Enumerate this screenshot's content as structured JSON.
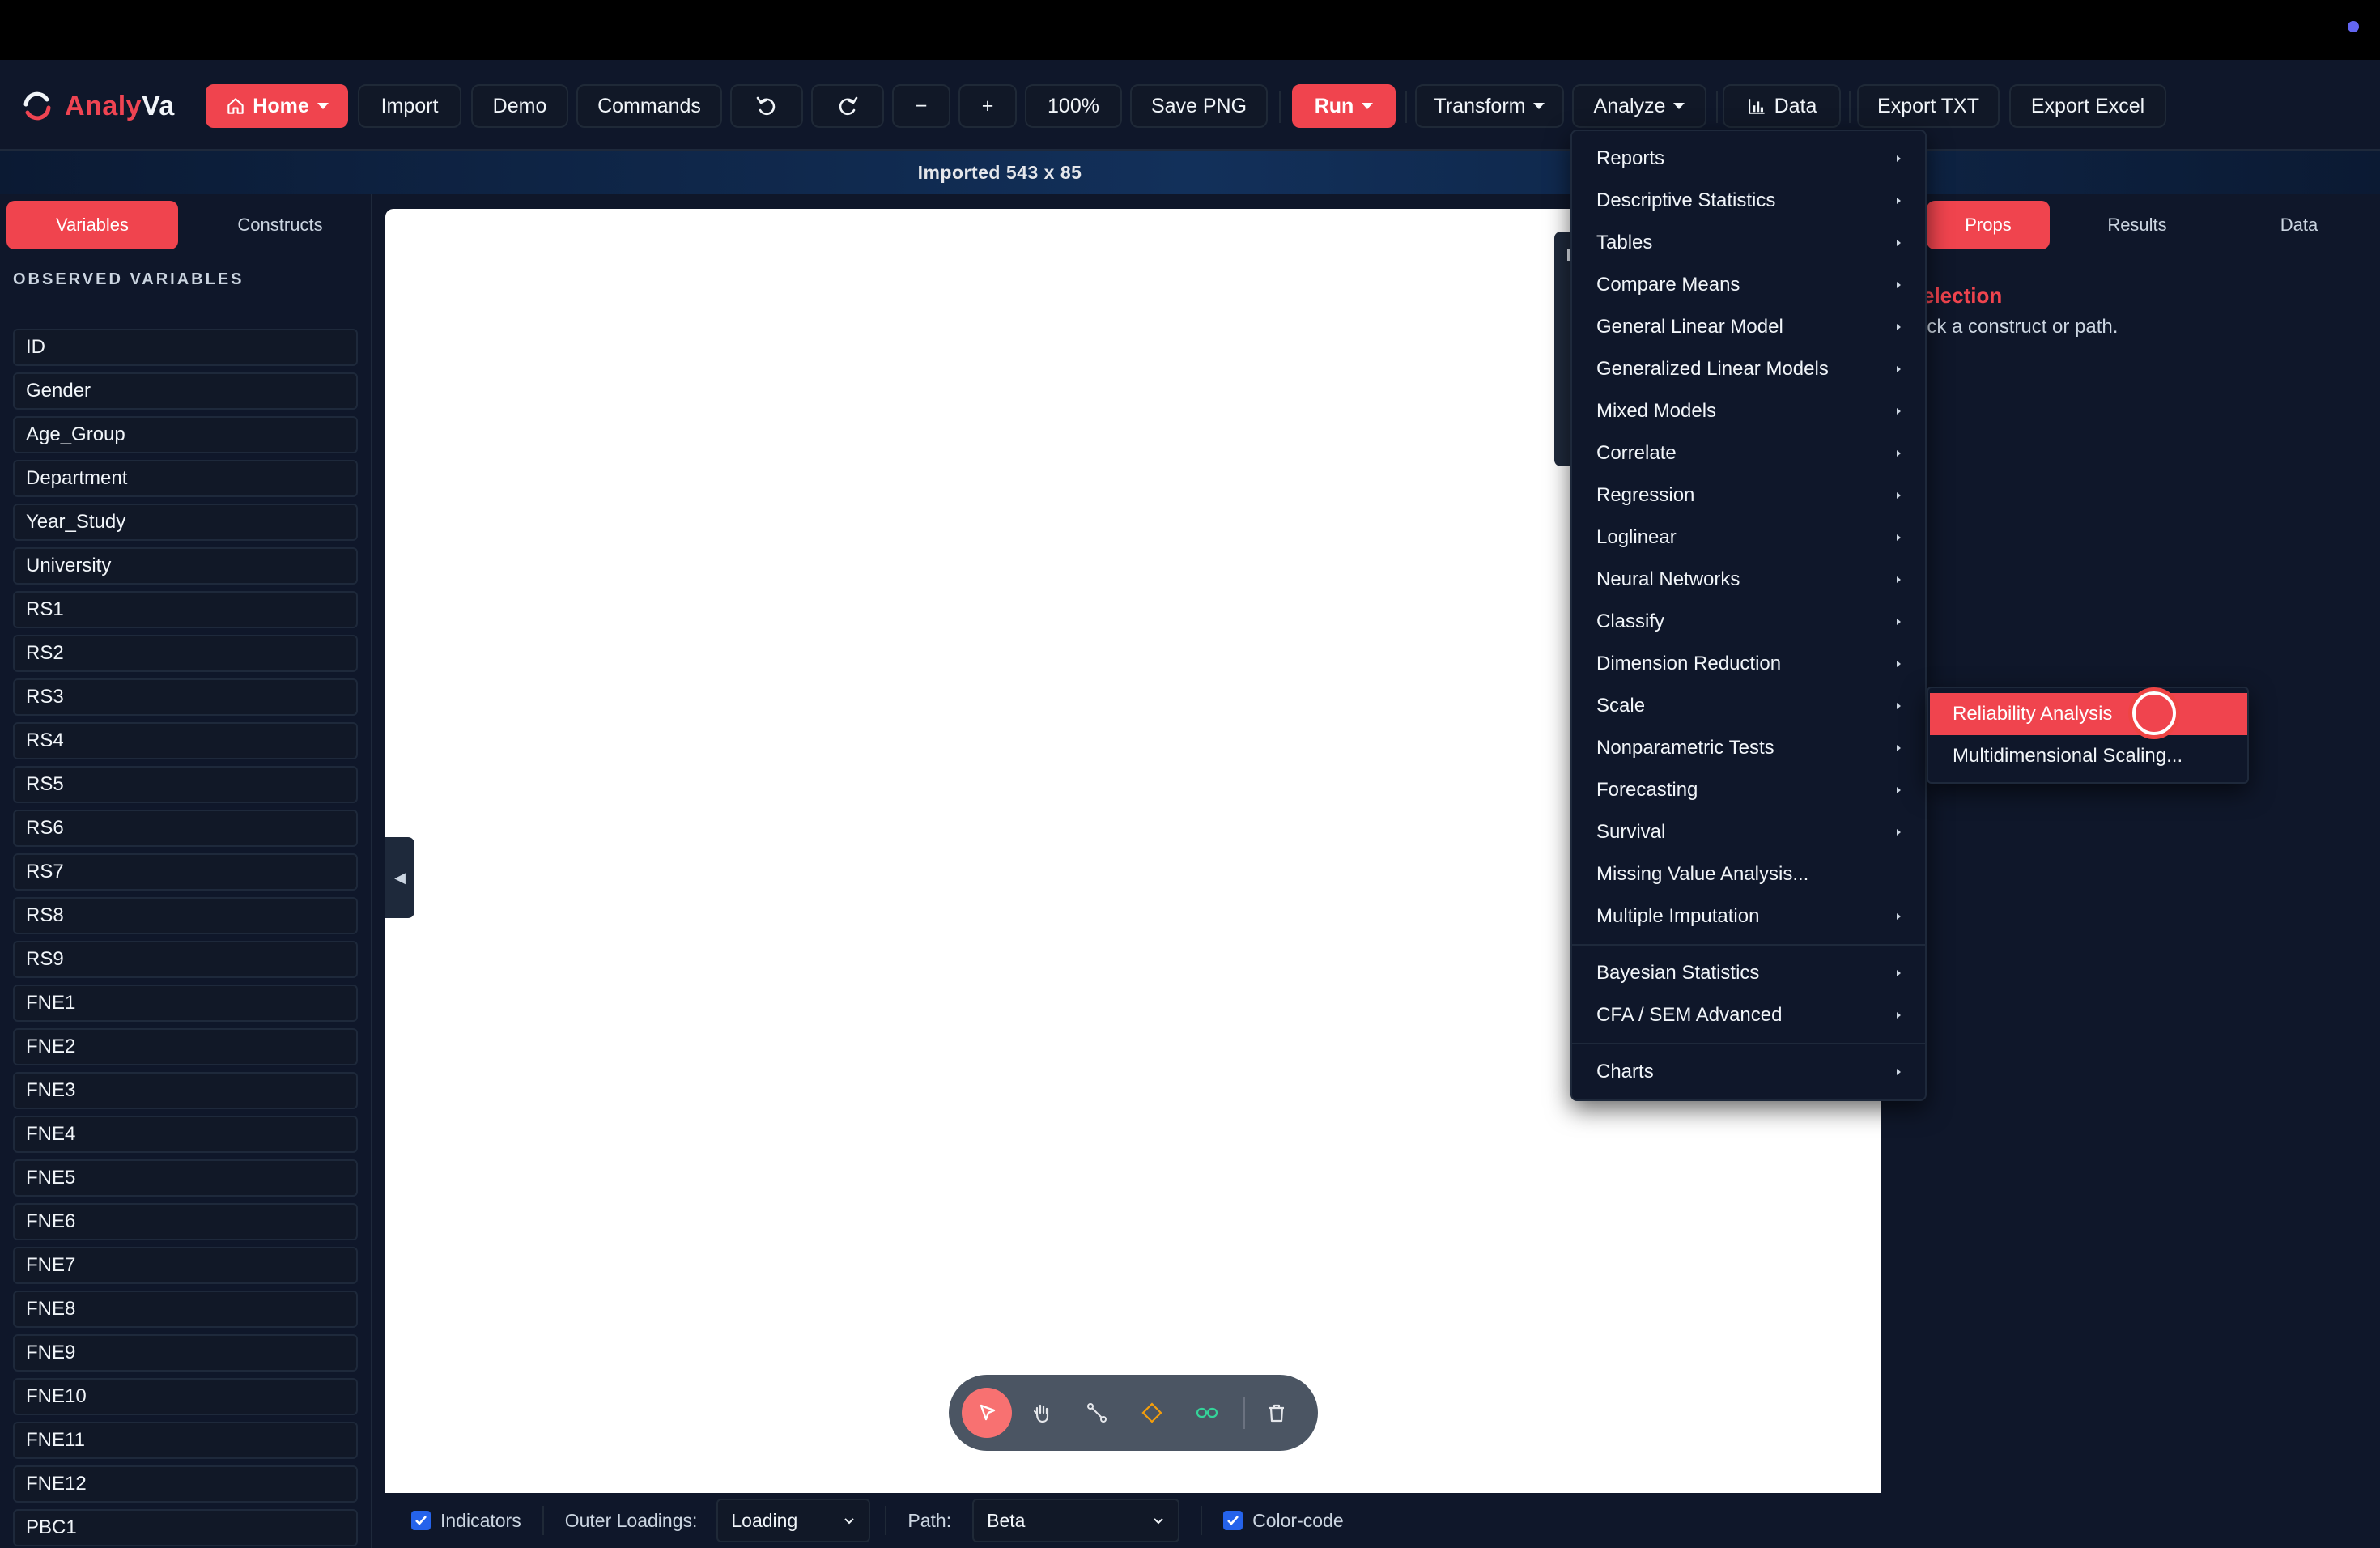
{
  "app": {
    "brand_part1": "Analy",
    "brand_part2": "Va"
  },
  "toolbar": {
    "home": "Home",
    "import": "Import",
    "demo": "Demo",
    "commands": "Commands",
    "zoom_out": "−",
    "zoom_in": "+",
    "zoom": "100%",
    "save_png": "Save PNG",
    "run": "Run",
    "transform": "Transform",
    "analyze": "Analyze",
    "data": "Data",
    "export_txt": "Export TXT",
    "export_excel": "Export Excel"
  },
  "status": {
    "message": "Imported 543 x 85"
  },
  "left": {
    "tabs": [
      "Variables",
      "Constructs"
    ],
    "section_title": "OBSERVED VARIABLES",
    "variables": [
      "ID",
      "Gender",
      "Age_Group",
      "Department",
      "Year_Study",
      "University",
      "RS1",
      "RS2",
      "RS3",
      "RS4",
      "RS5",
      "RS6",
      "RS7",
      "RS8",
      "RS9",
      "FNE1",
      "FNE2",
      "FNE3",
      "FNE4",
      "FNE5",
      "FNE6",
      "FNE7",
      "FNE8",
      "FNE9",
      "FNE10",
      "FNE11",
      "FNE12",
      "PBC1"
    ]
  },
  "right": {
    "tabs": [
      "Props",
      "Results",
      "Data"
    ],
    "selection_title": "election",
    "selection_hint": "ick a construct or path."
  },
  "menu": {
    "items": [
      {
        "label": "Reports",
        "submenu": true
      },
      {
        "label": "Descriptive Statistics",
        "submenu": true
      },
      {
        "label": "Tables",
        "submenu": true
      },
      {
        "label": "Compare Means",
        "submenu": true
      },
      {
        "label": "General Linear Model",
        "submenu": true
      },
      {
        "label": "Generalized Linear Models",
        "submenu": true
      },
      {
        "label": "Mixed Models",
        "submenu": true
      },
      {
        "label": "Correlate",
        "submenu": true
      },
      {
        "label": "Regression",
        "submenu": true
      },
      {
        "label": "Loglinear",
        "submenu": true
      },
      {
        "label": "Neural Networks",
        "submenu": true
      },
      {
        "label": "Classify",
        "submenu": true
      },
      {
        "label": "Dimension Reduction",
        "submenu": true
      },
      {
        "label": "Scale",
        "submenu": true
      },
      {
        "label": "Nonparametric Tests",
        "submenu": true
      },
      {
        "label": "Forecasting",
        "submenu": true
      },
      {
        "label": "Survival",
        "submenu": true
      },
      {
        "label": "Missing Value Analysis...",
        "submenu": false
      },
      {
        "label": "Multiple Imputation",
        "submenu": true
      },
      {
        "label": "Bayesian Statistics",
        "submenu": true
      },
      {
        "label": "CFA / SEM Advanced",
        "submenu": true
      },
      {
        "label": "Charts",
        "submenu": true
      }
    ],
    "scale_submenu": [
      "Reliability Analysis",
      "Multidimensional Scaling..."
    ]
  },
  "bottom": {
    "indicators": "Indicators",
    "outer_loadings_label": "Outer Loadings:",
    "outer_loadings_value": "Loading",
    "path_label": "Path:",
    "path_value": "Beta",
    "color_code": "Color-code"
  },
  "colors": {
    "accent": "#f0444e",
    "background": "#0f172a",
    "panel": "#111827"
  }
}
